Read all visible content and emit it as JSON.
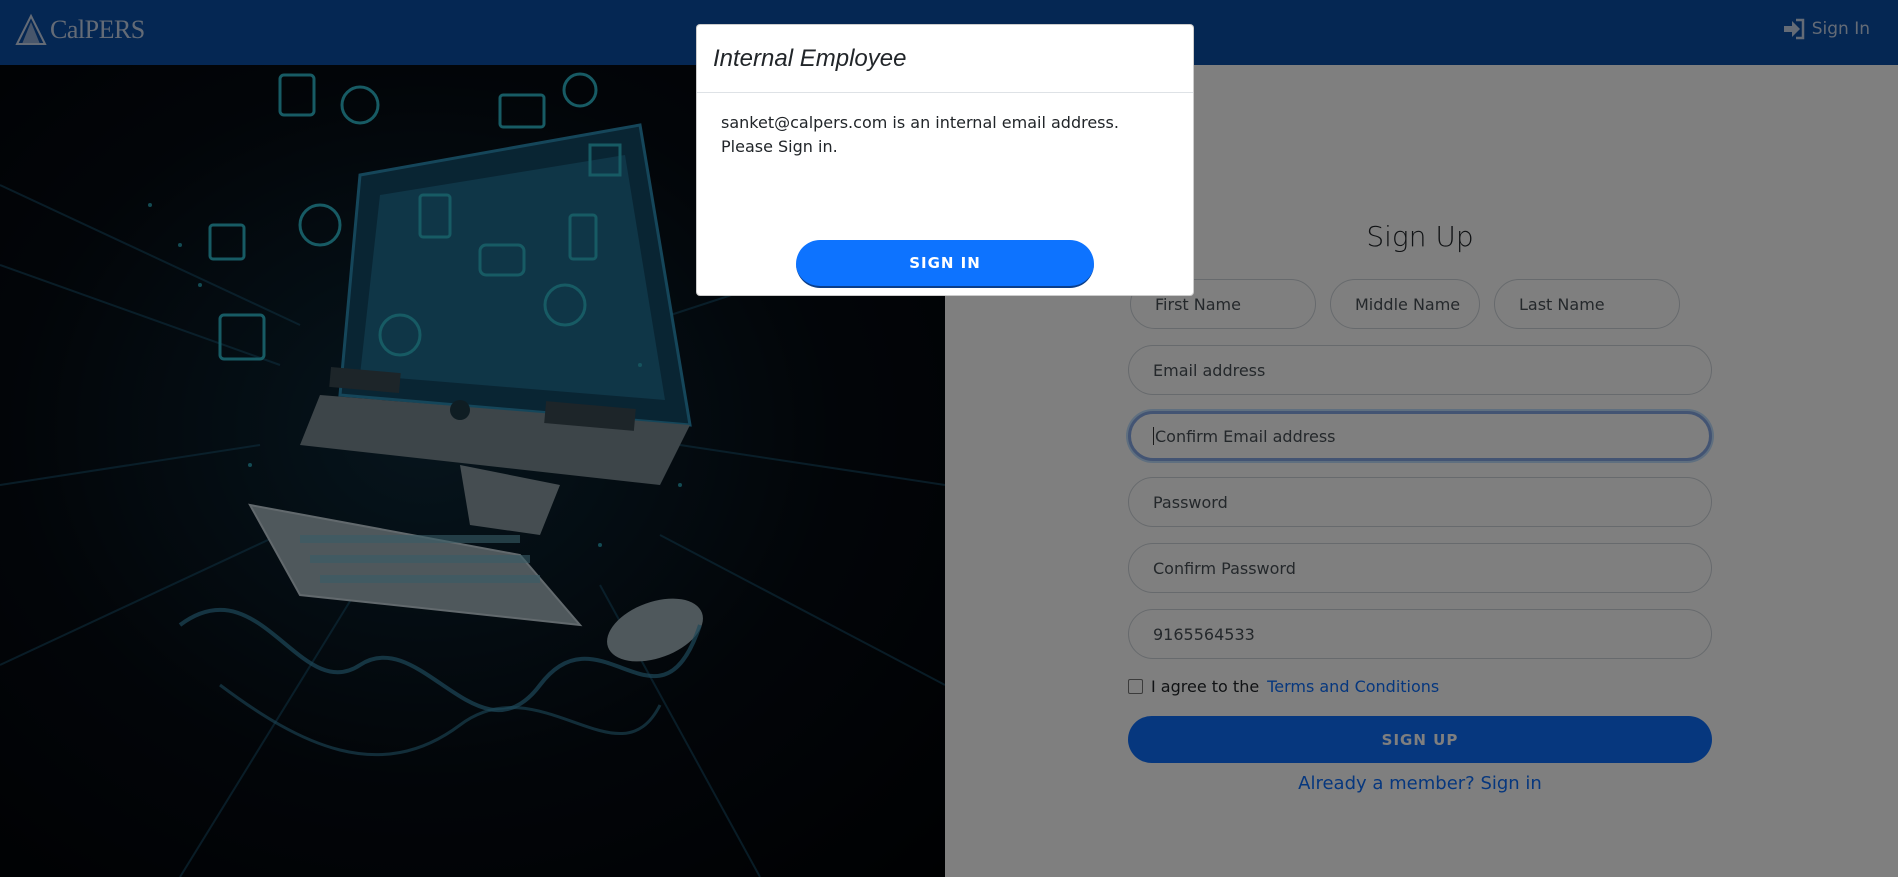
{
  "header": {
    "brand": "CalPERS",
    "signin_label": "Sign In"
  },
  "form": {
    "title": "Sign Up",
    "first_name_placeholder": "First Name",
    "middle_name_placeholder": "Middle Name",
    "last_name_placeholder": "Last Name",
    "email_placeholder": "Email address",
    "confirm_email_placeholder": "Confirm Email address",
    "password_placeholder": "Password",
    "confirm_password_placeholder": "Confirm Password",
    "phone_value": "9165564533",
    "terms_prefix": "I agree to the",
    "terms_link": "Terms and Conditions",
    "signup_label": "SIGN UP",
    "member_link": "Already a member? Sign in"
  },
  "modal": {
    "title": "Internal Employee",
    "message": "sanket@calpers.com is an internal email address. Please Sign in.",
    "signin_label": "SIGN IN"
  },
  "colors": {
    "header_bg": "#0a4fa6",
    "primary": "#0d6efd"
  }
}
